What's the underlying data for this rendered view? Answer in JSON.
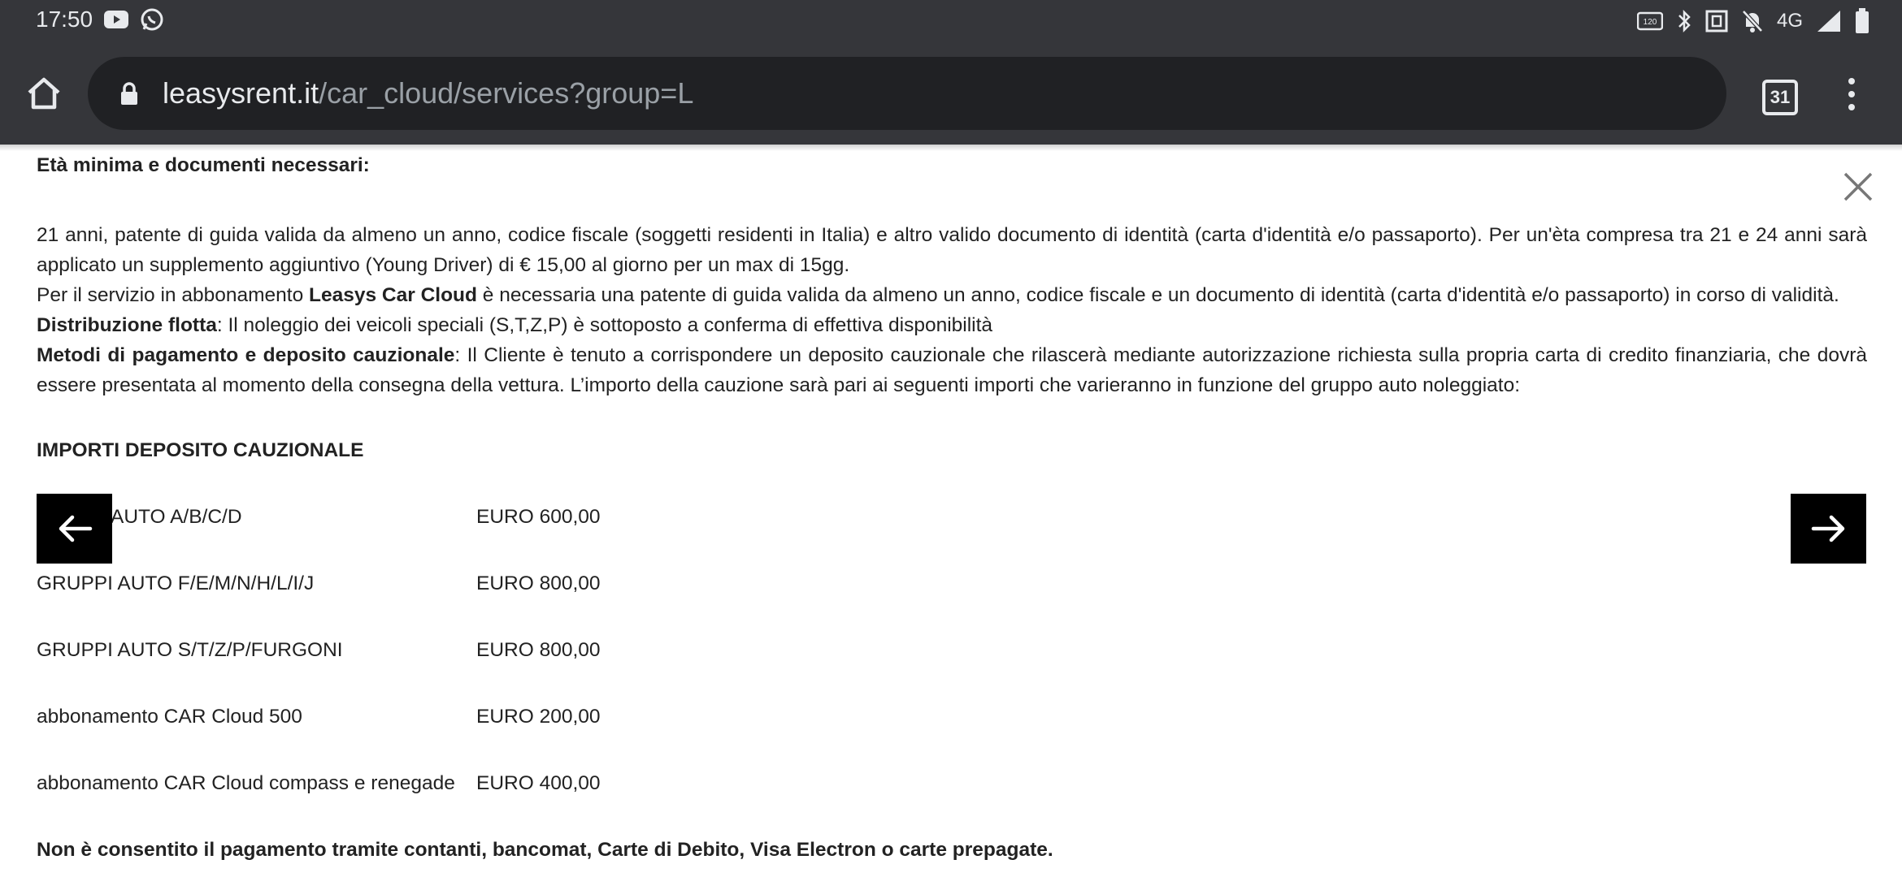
{
  "statusbar": {
    "time": "17:50",
    "icons": [
      "youtube-icon",
      "whatsapp-icon",
      "nfc-icon",
      "bluetooth-icon",
      "screen-icon",
      "mute-icon",
      "network-4g-icon",
      "signal-icon",
      "battery-icon"
    ],
    "network": "4G"
  },
  "browser": {
    "url_host": "leasysrent.it",
    "url_path": "/car_cloud/services?group=L",
    "tab_count": "31"
  },
  "content": {
    "section_title": "Età minima e documenti necessari:",
    "para1": "21 anni, patente di guida valida da almeno un anno, codice fiscale (soggetti residenti in Italia) e altro valido documento di identità (carta d'identità e/o passaporto). Per un'èta compresa tra 21 e 24 anni sarà applicato un supplemento aggiuntivo (Young Driver) di € 15,00 al giorno per un max di 15gg.",
    "para2_pre": "Per il servizio in abbonamento ",
    "para2_bold": "Leasys Car Cloud",
    "para2_post": " è necessaria una patente di guida valida da almeno un anno, codice fiscale e un documento di identità (carta d'identità e/o passaporto) in corso di validità.",
    "para3_bold": "Distribuzione flotta",
    "para3_post": ": Il noleggio dei veicoli speciali (S,T,Z,P) è sottoposto a conferma di effettiva disponibilità",
    "para4_bold": "Metodi di pagamento e deposito cauzionale",
    "para4_post": ": Il Cliente è tenuto a corrispondere un deposito cauzionale che rilascerà mediante autorizzazione richiesta sulla propria carta di credito finanziaria, che dovrà essere presentata al momento della consegna della vettura. L’importo della cauzione sarà pari ai seguenti importi che varieranno in funzione del gruppo auto noleggiato:",
    "deposit_heading": "IMPORTI DEPOSITO CAUZIONALE",
    "rows": [
      {
        "label": "AUTO A/B/C/D",
        "value": "EURO 600,00"
      },
      {
        "label": "GRUPPI AUTO F/E/M/N/H/L/I/J",
        "value": "EURO 800,00"
      },
      {
        "label": "GRUPPI AUTO S/T/Z/P/FURGONI",
        "value": "EURO 800,00"
      },
      {
        "label": "abbonamento CAR Cloud 500",
        "value": "EURO 200,00"
      },
      {
        "label": "abbonamento CAR Cloud compass e renegade",
        "value": "EURO 400,00"
      }
    ],
    "footer_note": "Non è consentito il pagamento tramite contanti, bancomat, Carte di Debito, Visa Electron o carte prepagate."
  }
}
